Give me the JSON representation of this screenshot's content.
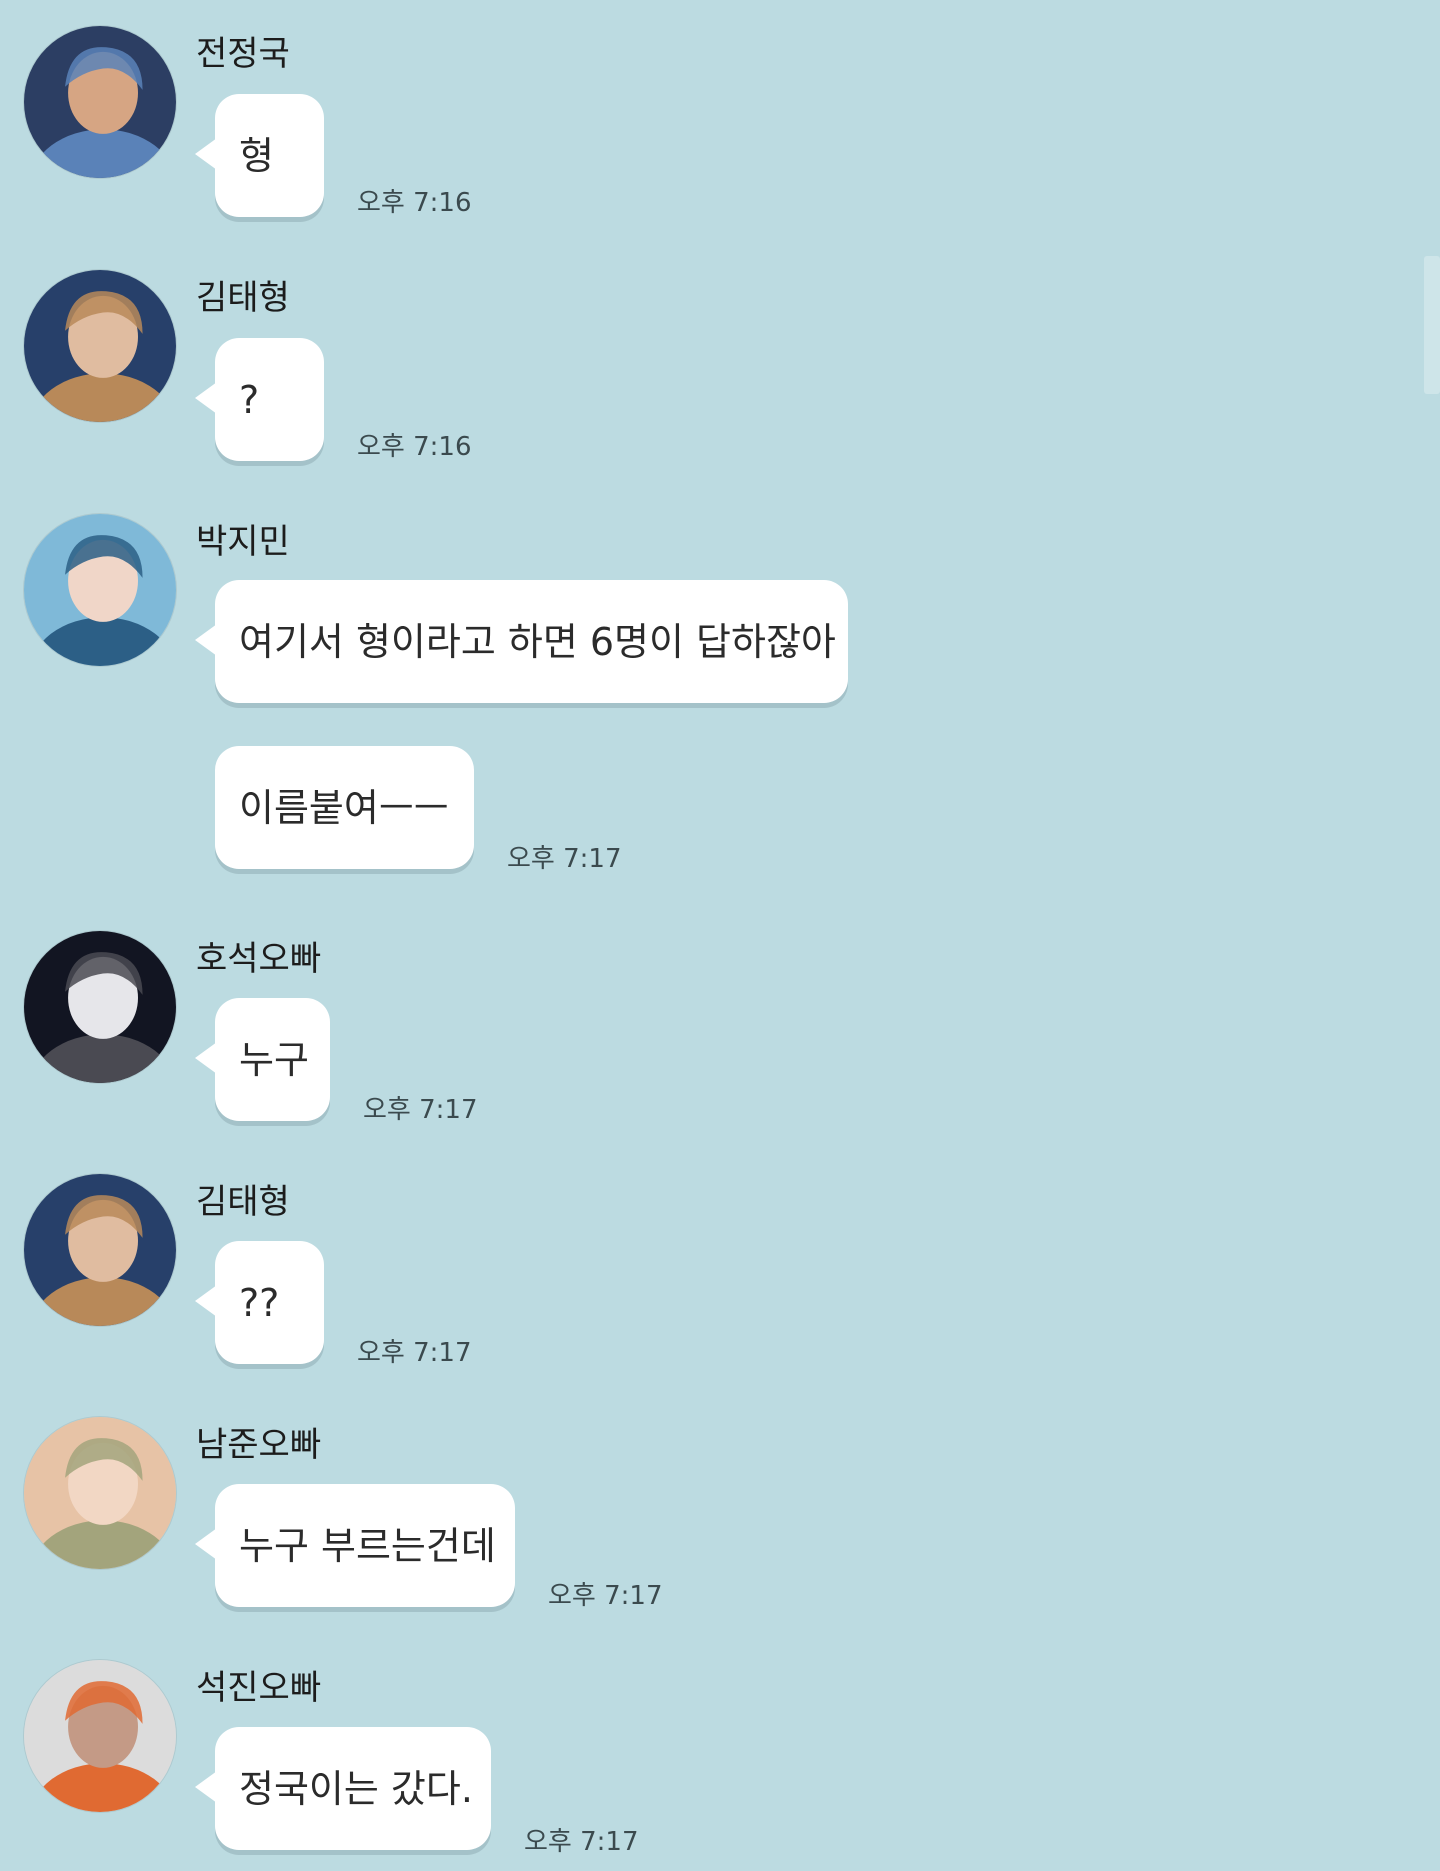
{
  "messages": [
    {
      "sender": "전정국",
      "lines": [
        "형"
      ],
      "time": "오후 7:16",
      "colors": [
        "#2c3e63",
        "#5a82b8",
        "#d6a583"
      ]
    },
    {
      "sender": "김태형",
      "lines": [
        "?"
      ],
      "time": "오후 7:16",
      "colors": [
        "#27406a",
        "#b88959",
        "#e0bca0"
      ]
    },
    {
      "sender": "박지민",
      "lines": [
        "여기서 형이라고 하면 6명이 답하잖아",
        "이름붙여ㅡㅡ"
      ],
      "time": "오후 7:17",
      "colors": [
        "#7fb9d8",
        "#2c5f86",
        "#f0d6c8"
      ]
    },
    {
      "sender": "호석오빠",
      "lines": [
        "누구"
      ],
      "time": "오후 7:17",
      "colors": [
        "#121522",
        "#4a4a52",
        "#e6e6ea"
      ]
    },
    {
      "sender": "김태형",
      "lines": [
        "??"
      ],
      "time": "오후 7:17",
      "colors": [
        "#27406a",
        "#b88959",
        "#e0bca0"
      ]
    },
    {
      "sender": "남준오빠",
      "lines": [
        "누구 부르는건데"
      ],
      "time": "오후 7:17",
      "colors": [
        "#e7c3a6",
        "#a3a47c",
        "#f2d7c4"
      ]
    },
    {
      "sender": "석진오빠",
      "lines": [
        "정국이는 갔다."
      ],
      "time": "오후 7:17",
      "colors": [
        "#dcdcdc",
        "#e06a32",
        "#c49a86"
      ]
    }
  ]
}
